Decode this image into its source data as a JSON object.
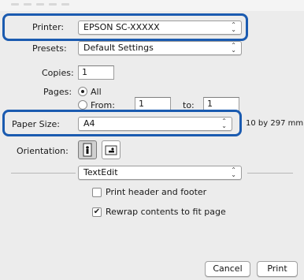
{
  "printer": {
    "label": "Printer:",
    "value": "EPSON SC-XXXXX"
  },
  "presets": {
    "label": "Presets:",
    "value": "Default Settings"
  },
  "copies": {
    "label": "Copies:",
    "value": "1"
  },
  "pages": {
    "label": "Pages:",
    "all_label": "All",
    "from_label": "From:",
    "from_value": "1",
    "to_label": "to:",
    "to_value": "1"
  },
  "paper_size": {
    "label": "Paper Size:",
    "value": "A4",
    "dimensions": "10 by 297 mm"
  },
  "orientation": {
    "label": "Orientation:"
  },
  "app_section": {
    "value": "TextEdit"
  },
  "options": {
    "print_header_footer": {
      "label": "Print header and footer",
      "checked": false
    },
    "rewrap": {
      "label": "Rewrap contents to fit page",
      "checked": true,
      "mark": "✔"
    }
  },
  "buttons": {
    "cancel": "Cancel",
    "print": "Print"
  },
  "popup_arrows": "⌃⌄",
  "colors": {
    "highlight": "#1b5bb0",
    "background": "#ececec"
  }
}
